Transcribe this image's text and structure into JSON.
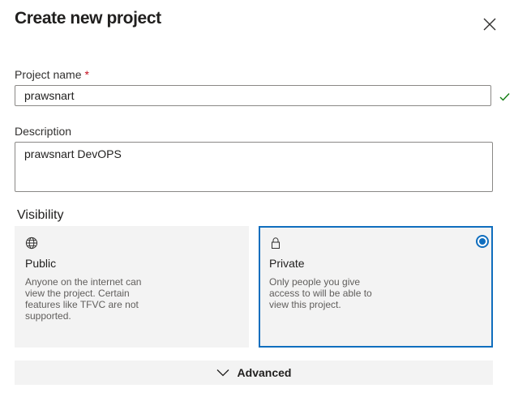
{
  "dialog": {
    "title": "Create new project"
  },
  "fields": {
    "project_name": {
      "label": "Project name",
      "required_marker": "*",
      "value": "prawsnart"
    },
    "description": {
      "label": "Description",
      "value": "prawsnart DevOPS"
    }
  },
  "visibility": {
    "label": "Visibility",
    "selected": "Private",
    "options": [
      {
        "title": "Public",
        "icon": "globe-icon",
        "description": "Anyone on the internet can view the project. Certain features like TFVC are not supported."
      },
      {
        "title": "Private",
        "icon": "lock-icon",
        "description": "Only people you give access to will be able to view this project."
      }
    ]
  },
  "advanced": {
    "label": "Advanced",
    "icon": "chevron-down-icon"
  },
  "icons": {
    "close": "close-icon",
    "valid": "checkmark-icon"
  },
  "colors": {
    "accent": "#106ebe",
    "required": "#c50f1f",
    "valid": "#107c10",
    "card_bg": "#f3f3f3"
  }
}
